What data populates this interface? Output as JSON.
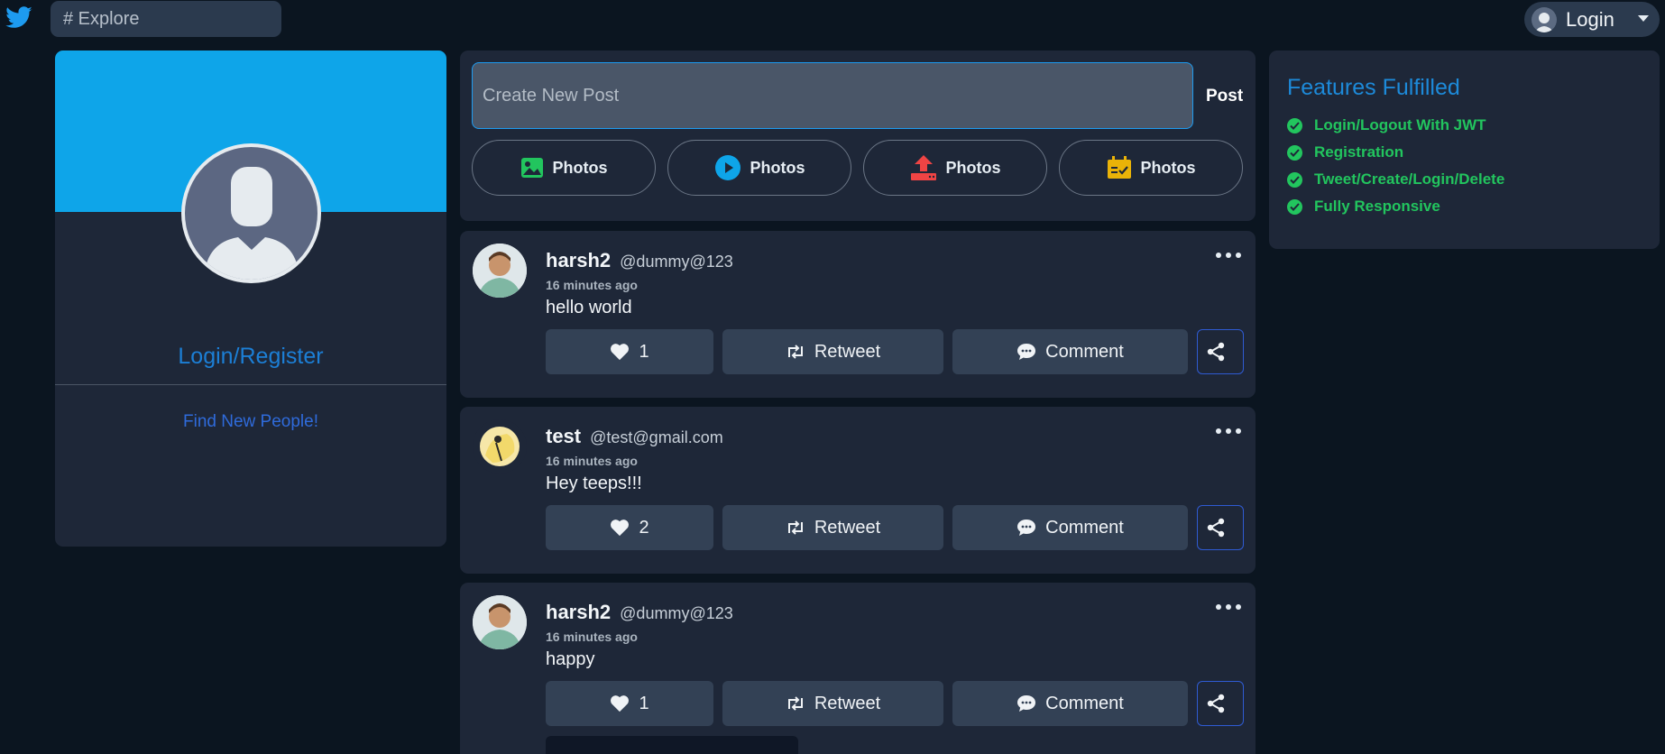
{
  "topbar": {
    "search_placeholder": "# Explore",
    "login_label": "Login"
  },
  "profile": {
    "login_register": "Login/Register",
    "find_people": "Find New People!"
  },
  "create_post": {
    "placeholder": "Create New Post",
    "post_label": "Post",
    "media_buttons": [
      {
        "label": "Photos",
        "icon": "image-icon",
        "color": "#22c55e"
      },
      {
        "label": "Photos",
        "icon": "play-circle-icon",
        "color": "#0ea5e9"
      },
      {
        "label": "Photos",
        "icon": "upload-icon",
        "color": "#ef4444"
      },
      {
        "label": "Photos",
        "icon": "calendar-check-icon",
        "color": "#eab308"
      }
    ]
  },
  "tweets": [
    {
      "name": "harsh2",
      "handle": "@dummy@123",
      "time": "16 minutes ago",
      "text": "hello world",
      "likes": "1",
      "retweet_label": "Retweet",
      "comment_label": "Comment"
    },
    {
      "name": "test",
      "handle": "@test@gmail.com",
      "time": "16 minutes ago",
      "text": "Hey teeps!!!",
      "likes": "2",
      "retweet_label": "Retweet",
      "comment_label": "Comment"
    },
    {
      "name": "harsh2",
      "handle": "@dummy@123",
      "time": "16 minutes ago",
      "text": "happy",
      "likes": "1",
      "retweet_label": "Retweet",
      "comment_label": "Comment"
    }
  ],
  "features": {
    "title": "Features Fulfilled",
    "items": [
      "Login/Logout With JWT",
      "Registration",
      "Tweet/Create/Login/Delete",
      "Fully Responsive"
    ]
  },
  "colors": {
    "accent": "#0ea5e9",
    "feature_green": "#22c55e",
    "card_bg": "#1e2738",
    "page_bg": "#0b1520"
  }
}
